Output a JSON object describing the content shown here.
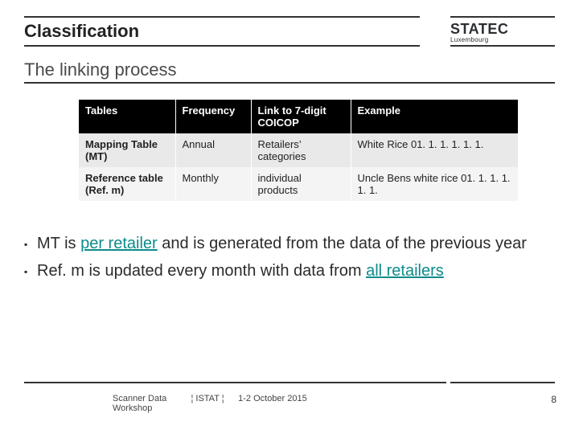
{
  "brand": {
    "name": "STATEC",
    "sub": "Luxembourg"
  },
  "section_title": "Classification",
  "subtitle": "The linking process",
  "table": {
    "headers": [
      "Tables",
      "Frequency",
      "Link to 7-digit COICOP",
      "Example"
    ],
    "rows": [
      [
        "Mapping Table (MT)",
        "Annual",
        "Retailers’ categories",
        "White Rice 01. 1. 1. 1. 1. 1."
      ],
      [
        "Reference table (Ref. m)",
        "Monthly",
        "individual products",
        "Uncle Bens white rice 01. 1. 1. 1. 1. 1."
      ]
    ]
  },
  "bullets": {
    "b1_pre": "MT is ",
    "b1_ul": "per retailer",
    "b1_post": " and is generated from the data of the previous year",
    "b2_pre": "Ref. m is updated every month with data from ",
    "b2_ul": "all retailers"
  },
  "footer": {
    "left": "Scanner Data Workshop",
    "mid": "¦ ISTAT ¦",
    "right": "1-2 October 2015",
    "page": "8"
  }
}
